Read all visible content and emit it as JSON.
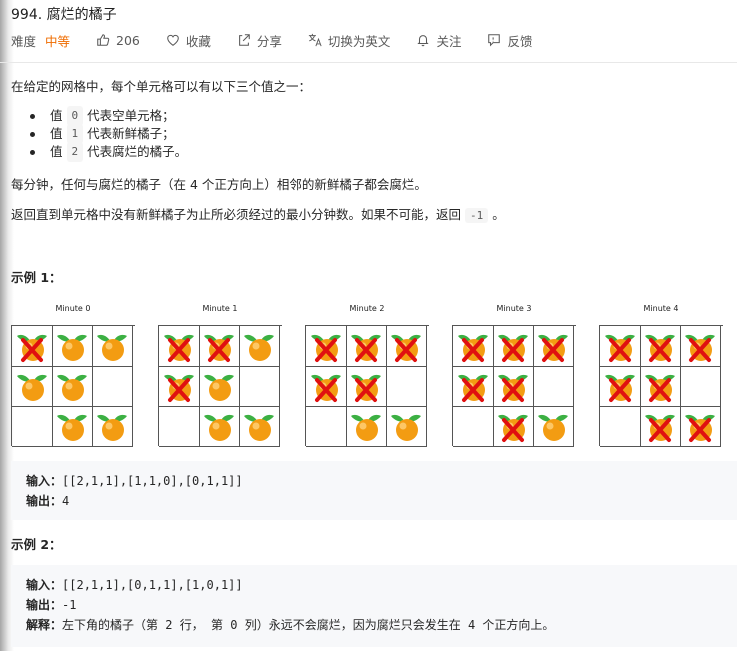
{
  "problem": {
    "title": "994. 腐烂的橘子",
    "difficulty_label": "难度",
    "difficulty_value": "中等"
  },
  "actions": {
    "likes": "206",
    "favorite": "收藏",
    "share": "分享",
    "switch_lang": "切换为英文",
    "follow": "关注",
    "feedback": "反馈"
  },
  "description": {
    "intro": "在给定的网格中，每个单元格可以有以下三个值之一：",
    "bullets": [
      {
        "prefix": "值",
        "code": "0",
        "suffix": "代表空单元格；"
      },
      {
        "prefix": "值",
        "code": "1",
        "suffix": "代表新鲜橘子；"
      },
      {
        "prefix": "值",
        "code": "2",
        "suffix": "代表腐烂的橘子。"
      }
    ],
    "rule": "每分钟，任何与腐烂的橘子（在 4 个正方向上）相邻的新鲜橘子都会腐烂。",
    "question_pre": "返回直到单元格中没有新鲜橘子为止所必须经过的最小分钟数。如果不可能，返回",
    "question_code": "-1",
    "question_post": "。"
  },
  "example1": {
    "heading": "示例 1：",
    "minutes": [
      {
        "label": "Minute 0",
        "grid": [
          [
            2,
            1,
            1
          ],
          [
            1,
            1,
            0
          ],
          [
            0,
            1,
            1
          ]
        ]
      },
      {
        "label": "Minute 1",
        "grid": [
          [
            2,
            2,
            1
          ],
          [
            2,
            1,
            0
          ],
          [
            0,
            1,
            1
          ]
        ]
      },
      {
        "label": "Minute 2",
        "grid": [
          [
            2,
            2,
            2
          ],
          [
            2,
            2,
            0
          ],
          [
            0,
            1,
            1
          ]
        ]
      },
      {
        "label": "Minute 3",
        "grid": [
          [
            2,
            2,
            2
          ],
          [
            2,
            2,
            0
          ],
          [
            0,
            2,
            1
          ]
        ]
      },
      {
        "label": "Minute 4",
        "grid": [
          [
            2,
            2,
            2
          ],
          [
            2,
            2,
            0
          ],
          [
            0,
            2,
            2
          ]
        ]
      }
    ],
    "input_label": "输入：",
    "input_value": "[[2,1,1],[1,1,0],[0,1,1]]",
    "output_label": "输出：",
    "output_value": "4"
  },
  "example2": {
    "heading": "示例 2：",
    "input_label": "输入：",
    "input_value": "[[2,1,1],[0,1,1],[1,0,1]]",
    "output_label": "输出：",
    "output_value": "-1",
    "explain_label": "解释：",
    "explain_p1": "左下角的橘子（第",
    "explain_c1": "2",
    "explain_p2": "行，",
    "explain_p3": "第",
    "explain_c2": "0",
    "explain_p4": "列）永远不会腐烂，因为腐烂只会发生在",
    "explain_c3": "4",
    "explain_p5": "个正方向上。"
  },
  "colors": {
    "accent": "#ef6c00",
    "orange": "#f39c12",
    "leaf": "#3cb043",
    "rotten_x": "#e01010"
  }
}
